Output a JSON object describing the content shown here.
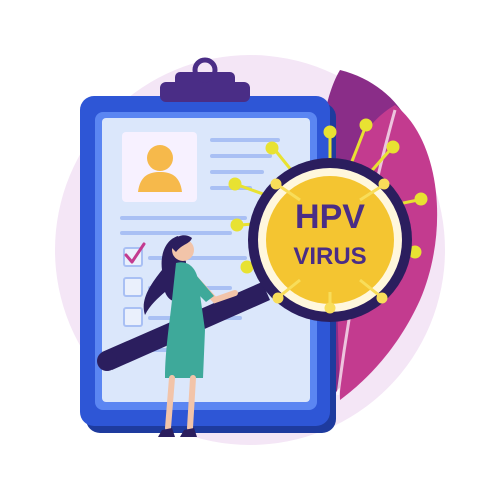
{
  "illustration": {
    "badge": {
      "line1": "HPV",
      "line2": "VIRUS"
    },
    "colors": {
      "background_blob": "#f4e6f6",
      "leaf_purple": "#8a2d88",
      "leaf_magenta": "#c33b8f",
      "clipboard_frame": "#2e56d6",
      "clipboard_inner": "#5b86f2",
      "clipboard_edge": "#1e3b9e",
      "paper": "#dbe7fb",
      "paper_lines": "#a9c0f4",
      "photo_bg": "#f7f1ff",
      "avatar": "#f6b94b",
      "clip": "#4a2d86",
      "check": "#c33b8f",
      "magnifier_handle": "#2b1e5e",
      "magnifier_ring": "#2b1e5e",
      "virus_yellow": "#f4c531",
      "virus_spikes": "#e8e232",
      "virus_text": "#4a2d86",
      "woman_dress": "#3ea99a",
      "woman_hair": "#2b1e5e",
      "woman_skin": "#f2c4a9"
    }
  }
}
